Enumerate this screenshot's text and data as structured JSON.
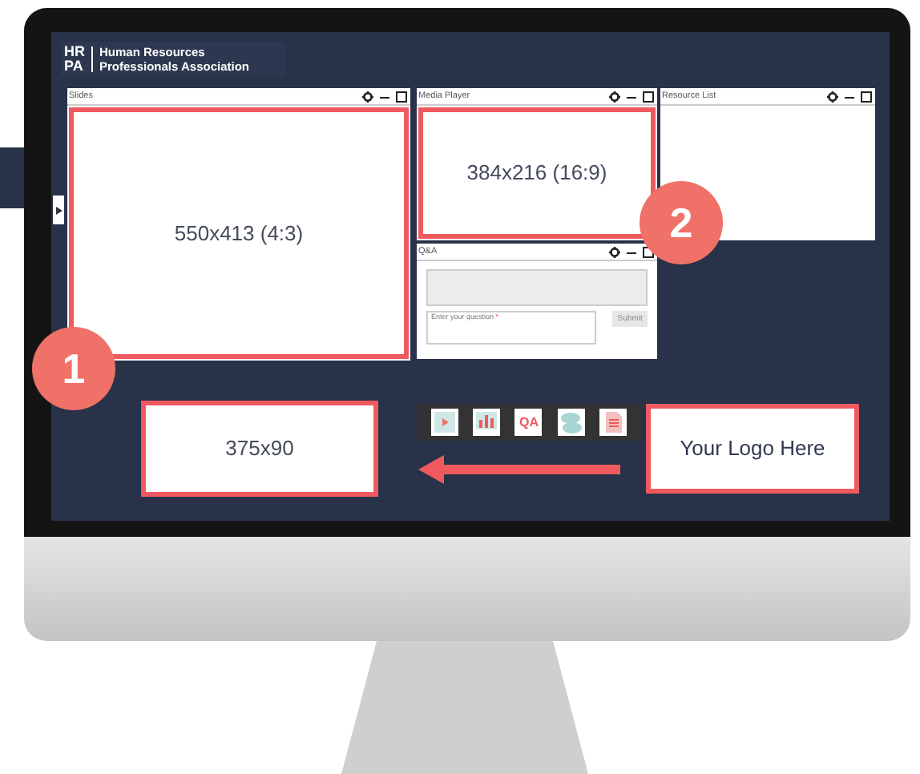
{
  "logo": {
    "mark_top": "HR",
    "mark_bottom": "PA",
    "line_1": "Human Resources",
    "line_2": "Professionals Association"
  },
  "windows": [
    {
      "kind": "slides",
      "title": "Slides",
      "content": "550x413 (4:3)"
    },
    {
      "kind": "media",
      "title": "Media Player",
      "content": "384x216 (16:9)"
    },
    {
      "kind": "list",
      "title": "Resource List"
    },
    {
      "kind": "qa",
      "title": "Q&A",
      "placeholder": "Enter your question ",
      "required_mark": "*",
      "button": "Submit"
    }
  ],
  "badges": [
    "1",
    "2"
  ],
  "banner_box": "375x90",
  "toolbar": [
    {
      "kind": "video"
    },
    {
      "kind": "poll"
    },
    {
      "kind": "qa",
      "label": "QA"
    },
    {
      "kind": "chat"
    },
    {
      "kind": "document"
    }
  ],
  "logo_box": "Your Logo Here"
}
